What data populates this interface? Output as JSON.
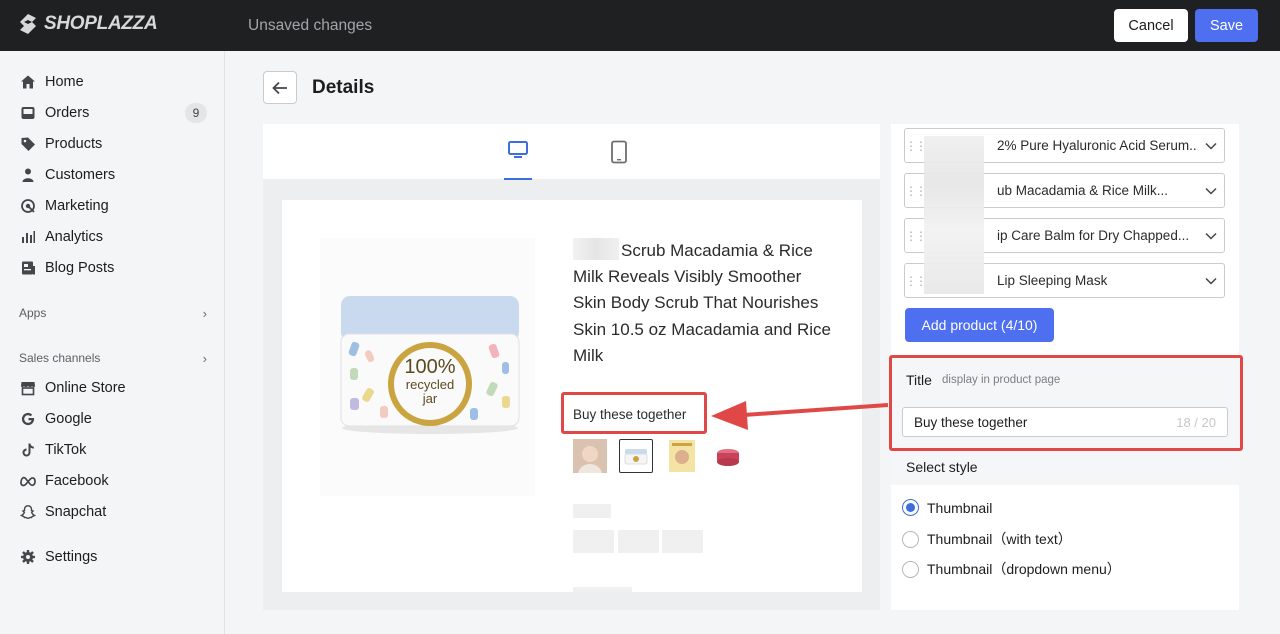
{
  "topbar": {
    "logo_text": "SHOPLAZZA",
    "status": "Unsaved changes",
    "cancel_label": "Cancel",
    "save_label": "Save"
  },
  "sidebar": {
    "items": [
      {
        "label": "Home",
        "icon": "home-icon"
      },
      {
        "label": "Orders",
        "icon": "inbox-icon",
        "badge": "9"
      },
      {
        "label": "Products",
        "icon": "tag-icon"
      },
      {
        "label": "Customers",
        "icon": "person-icon"
      },
      {
        "label": "Marketing",
        "icon": "target-icon"
      },
      {
        "label": "Analytics",
        "icon": "bar-chart-icon"
      },
      {
        "label": "Blog Posts",
        "icon": "document-icon"
      }
    ],
    "apps_label": "Apps",
    "channels_label": "Sales channels",
    "channels": [
      {
        "label": "Online Store",
        "icon": "store-icon"
      },
      {
        "label": "Google",
        "icon": "google-icon"
      },
      {
        "label": "TikTok",
        "icon": "tiktok-icon"
      },
      {
        "label": "Facebook",
        "icon": "meta-icon"
      },
      {
        "label": "Snapchat",
        "icon": "ghost-icon"
      }
    ],
    "settings_label": "Settings"
  },
  "page": {
    "title": "Details"
  },
  "preview": {
    "jar_text_1": "100%",
    "jar_text_2": "recycled",
    "jar_text_3": "jar",
    "product_title": "Scrub Macadamia & Rice Milk Reveals Visibly Smoother Skin Body Scrub That Nourishes Skin 10.5 oz Macadamia and Rice Milk",
    "bundle_label": "Buy these together"
  },
  "products": [
    {
      "name": "2% Pure Hyaluronic Acid Serum..."
    },
    {
      "name": "ub Macadamia & Rice Milk..."
    },
    {
      "name": "ip Care Balm for Dry Chapped..."
    },
    {
      "name": "Lip Sleeping Mask"
    }
  ],
  "add_product_label": "Add product (4/10)",
  "title_field": {
    "label": "Title",
    "hint": "display in product page",
    "value": "Buy these together",
    "counter": "18 / 20"
  },
  "style_section": {
    "label": "Select style",
    "options": [
      "Thumbnail",
      "Thumbnail（with text）",
      "Thumbnail（dropdown menu）"
    ],
    "selected": "Thumbnail"
  },
  "colors": {
    "accent": "#4e6ff0",
    "annotation": "#e04848",
    "topbar": "#1f2022"
  }
}
